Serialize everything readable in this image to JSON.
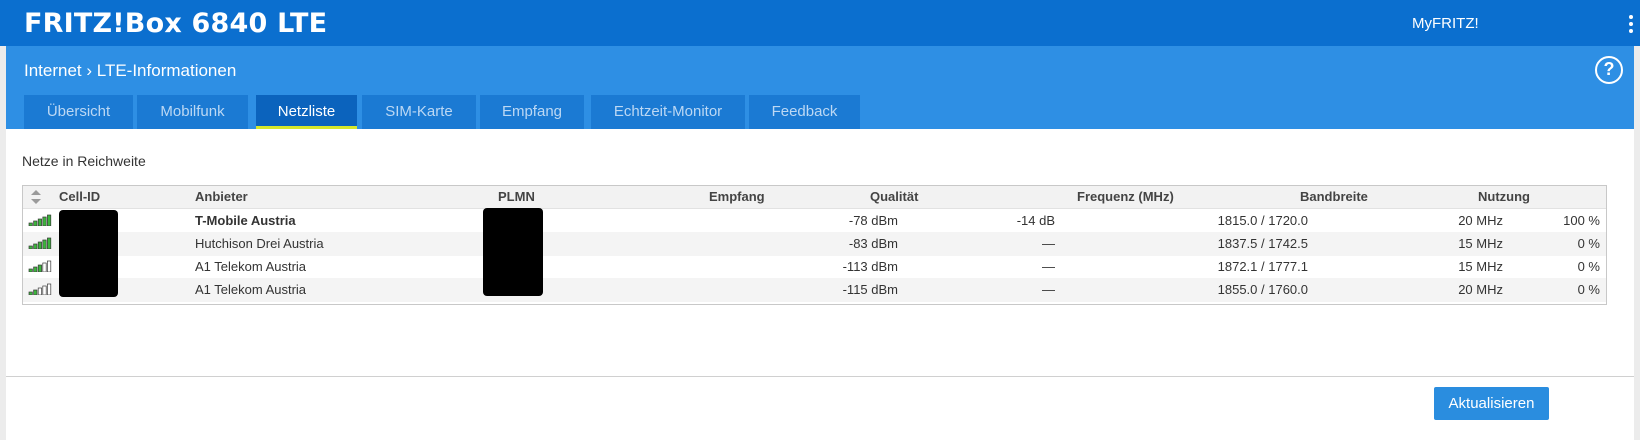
{
  "app": {
    "product": "FRITZ!Box 6840 LTE",
    "myfritz": "MyFRITZ!"
  },
  "header": {
    "breadcrumb": "Internet › LTE-Informationen",
    "help": "?"
  },
  "tabs": [
    {
      "label": "Übersicht"
    },
    {
      "label": "Mobilfunk"
    },
    {
      "label": "Netzliste",
      "active": true
    },
    {
      "label": "SIM-Karte"
    },
    {
      "label": "Empfang"
    },
    {
      "label": "Echtzeit-Monitor"
    },
    {
      "label": "Feedback"
    }
  ],
  "main": {
    "section_title": "Netze in Reichweite",
    "columns": [
      "Cell-ID",
      "Anbieter",
      "PLMN",
      "Empfang",
      "Qualität",
      "Frequenz (MHz)",
      "Bandbreite",
      "Nutzung"
    ],
    "rows": [
      {
        "signal_bars": 5,
        "provider": "T-Mobile Austria",
        "reception": "-78 dBm",
        "quality": "-14 dB",
        "frequency": "1815.0 / 1720.0",
        "bandwidth": "20 MHz",
        "usage": "100 %"
      },
      {
        "signal_bars": 5,
        "provider": "Hutchison Drei Austria",
        "reception": "-83 dBm",
        "quality": "—",
        "frequency": "1837.5 / 1742.5",
        "bandwidth": "15 MHz",
        "usage": "0 %"
      },
      {
        "signal_bars": 3,
        "provider": "A1 Telekom Austria",
        "reception": "-113 dBm",
        "quality": "—",
        "frequency": "1872.1 / 1777.1",
        "bandwidth": "15 MHz",
        "usage": "0 %"
      },
      {
        "signal_bars": 2,
        "provider": "A1 Telekom Austria",
        "reception": "-115 dBm",
        "quality": "—",
        "frequency": "1855.0 / 1760.0",
        "bandwidth": "20 MHz",
        "usage": "0 %"
      }
    ]
  },
  "footer": {
    "refresh_label": "Aktualisieren"
  },
  "colors": {
    "topbar": "#0b6fcf",
    "header": "#2e8fe4",
    "tab": "#1b7ad3",
    "tab_active": "#0b63bd",
    "tab_indicator": "#d6e82c",
    "signal_on": "#3cb43c"
  }
}
